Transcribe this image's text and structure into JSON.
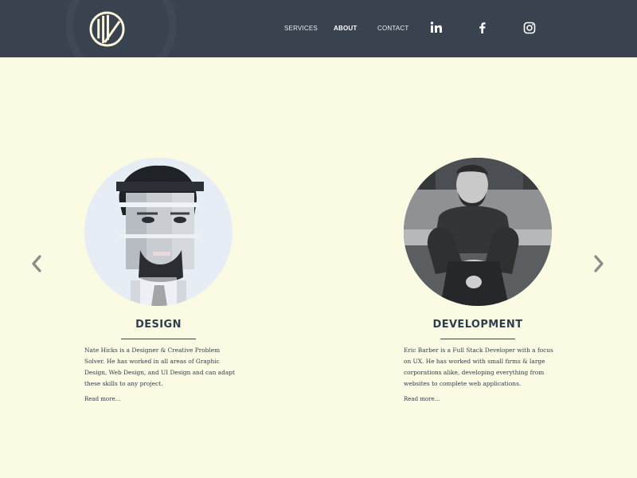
{
  "colors": {
    "header_bg": "#38434f",
    "page_bg": "#fbfae3",
    "heading": "#2f3d4c",
    "arrow": "#8b8b88"
  },
  "header": {
    "logo_icon": "circle-slash-logo-icon",
    "nav": [
      {
        "label": "SERVICES",
        "active": false
      },
      {
        "label": "ABOUT",
        "active": true
      },
      {
        "label": "CONTACT",
        "active": false
      }
    ],
    "social": [
      "linkedin-icon",
      "facebook-icon",
      "instagram-icon"
    ]
  },
  "carousel": {
    "prev_icon": "chevron-left-icon",
    "next_icon": "chevron-right-icon",
    "cards": [
      {
        "title": "DESIGN",
        "text": "Nate Hicks is a Designer & Creative Problem Solver. He has worked in all areas of Graphic Design, Web Design, and UI Design and can adapt these skills to any project.",
        "read_more": "Read more..."
      },
      {
        "title": "DEVELOPMENT",
        "text": "Eric Barber is a Full Stack Developer with a focus on UX. He has worked with small firms & large corporations alike, developing everything from websites to complete web applications.",
        "read_more": "Read more..."
      }
    ]
  }
}
